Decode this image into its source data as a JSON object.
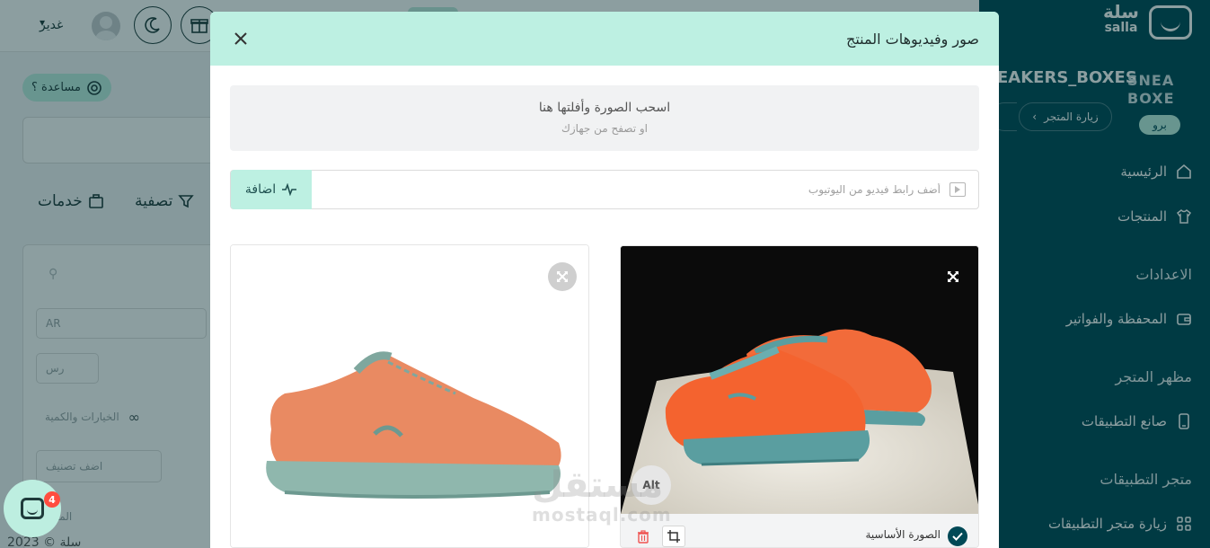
{
  "header": {
    "user_name": "غدير",
    "chevron": "⌄"
  },
  "help": {
    "label": "مساعدة ؟"
  },
  "toolbar": {
    "filter_label": "تصفية",
    "services_label": "خدمات"
  },
  "background_form": {
    "language_value": "AR",
    "cost_placeholder": "رس",
    "options_label": "الخيارات والكمية",
    "category_placeholder": "اضف تصنيف",
    "more_label": "المزيد",
    "copyright": "سلة © 2023"
  },
  "chat": {
    "badge_count": "4"
  },
  "sidebar": {
    "brand_ar": "سلة",
    "brand_en": "salla",
    "store_name": "EAKERS_BOXES",
    "store_logo_text": "SNEA BOXE",
    "visit_store_label": "زيارة المتجر",
    "pro_badge": "برو",
    "items": [
      {
        "label": "الرئيسية",
        "icon": "home-icon"
      },
      {
        "label": "المنتجات",
        "icon": "shirt-icon"
      }
    ],
    "section_settings": "الاعدادات",
    "wallet_label": "المحفظة والفواتير",
    "section_appearance": "مظهر المتجر",
    "app_builder_label": "صانع التطبيقات",
    "section_app_store": "متجر التطبيقات",
    "visit_app_store_label": "زيارة متجر التطبيقات"
  },
  "modal": {
    "title": "صور وفيديوهات المنتج",
    "dropzone_main": "اسحب الصورة وأفلتها هنا",
    "dropzone_sub": "او تصفح من جهازك",
    "video_placeholder": "أضف رابط فيديو من اليوتيوب",
    "add_button_label": "اضافة",
    "alt_label": "Alt",
    "main_image_label": "الصورة الأساسية"
  },
  "watermark": {
    "arabic": "مستقل",
    "latin": "mostaql.com"
  },
  "colors": {
    "sidebar_bg": "#004956",
    "accent_mint": "#bdf0e2",
    "badge_red": "#ff4d3f",
    "shoe_orange": "#f26b3a",
    "shoe_teal": "#5a9ea0"
  }
}
